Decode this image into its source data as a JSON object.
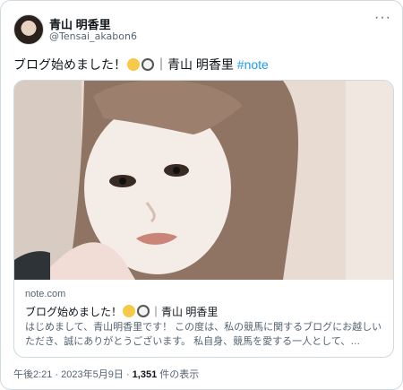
{
  "author": {
    "name": "青山 明香里",
    "handle": "@Tensai_akabon6"
  },
  "more_label": "···",
  "post": {
    "text_before": "ブログ始めました！",
    "text_after": "｜青山 明香里",
    "hashtag": "#note",
    "emojis": [
      "chick-icon",
      "magnifier-icon"
    ]
  },
  "link_card": {
    "domain": "note.com",
    "title_before": "ブログ始めました！",
    "title_after": "｜青山 明香里",
    "description": "はじめまして、青山明香里です！ この度は、私の競馬に関するブログにお越しいただき、誠にありがとうございます。 私自身、競馬を愛する一人として、…"
  },
  "meta": {
    "timestamp": "午後2:21 · 2023年5月9日",
    "separator": " · ",
    "views_count": "1,351",
    "views_label": " 件の表示"
  }
}
